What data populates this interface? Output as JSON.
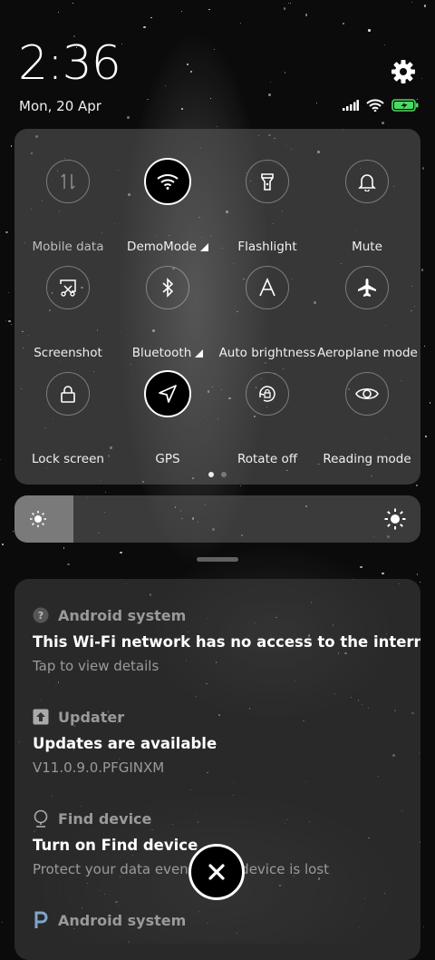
{
  "header": {
    "time": "2:36",
    "date": "Mon, 20 Apr",
    "settings_icon": "gear-icon",
    "status_icons": [
      "signal-icon",
      "wifi-icon",
      "battery-charging-icon"
    ]
  },
  "quick_settings": {
    "tiles": [
      {
        "label": "Mobile data",
        "icon": "mobile-data-icon",
        "active": false,
        "disabled": true
      },
      {
        "label": "DemoMode",
        "icon": "wifi-icon",
        "active": true,
        "has_menu": true
      },
      {
        "label": "Flashlight",
        "icon": "flashlight-icon",
        "active": false
      },
      {
        "label": "Mute",
        "icon": "bell-icon",
        "active": false
      },
      {
        "label": "Screenshot",
        "icon": "screenshot-icon",
        "active": false
      },
      {
        "label": "Bluetooth",
        "icon": "bluetooth-icon",
        "active": false,
        "has_menu": true
      },
      {
        "label": "Auto brightness",
        "icon": "auto-brightness-icon",
        "active": false
      },
      {
        "label": "Aeroplane mode",
        "icon": "airplane-icon",
        "active": false
      },
      {
        "label": "Lock screen",
        "icon": "lock-icon",
        "active": false
      },
      {
        "label": "GPS",
        "icon": "location-arrow-icon",
        "active": true
      },
      {
        "label": "Rotate off",
        "icon": "rotate-lock-icon",
        "active": false
      },
      {
        "label": "Reading mode",
        "icon": "eye-icon",
        "active": false
      }
    ],
    "page_count": 2,
    "current_page": 1
  },
  "brightness": {
    "level": 0.145,
    "low_icon": "brightness-low-icon",
    "high_icon": "brightness-high-icon"
  },
  "notifications": [
    {
      "app": "Android system",
      "app_icon": "question-icon",
      "title": "This Wi-Fi network has no access to the internet",
      "body": "Tap to view details"
    },
    {
      "app": "Updater",
      "app_icon": "upload-arrow-icon",
      "title": "Updates are available",
      "body": "V11.0.9.0.PFGINXM"
    },
    {
      "app": "Find device",
      "app_icon": "location-pin-icon",
      "title": "Turn on Find device",
      "body": "Protect your data even if your device is lost"
    },
    {
      "app": "Android system",
      "app_icon": "android-p-icon",
      "title": "",
      "body": ""
    }
  ],
  "clear_all_icon": "close-icon",
  "colors": {
    "battery_green": "#4cd964",
    "panel": "#5c5c5c"
  }
}
